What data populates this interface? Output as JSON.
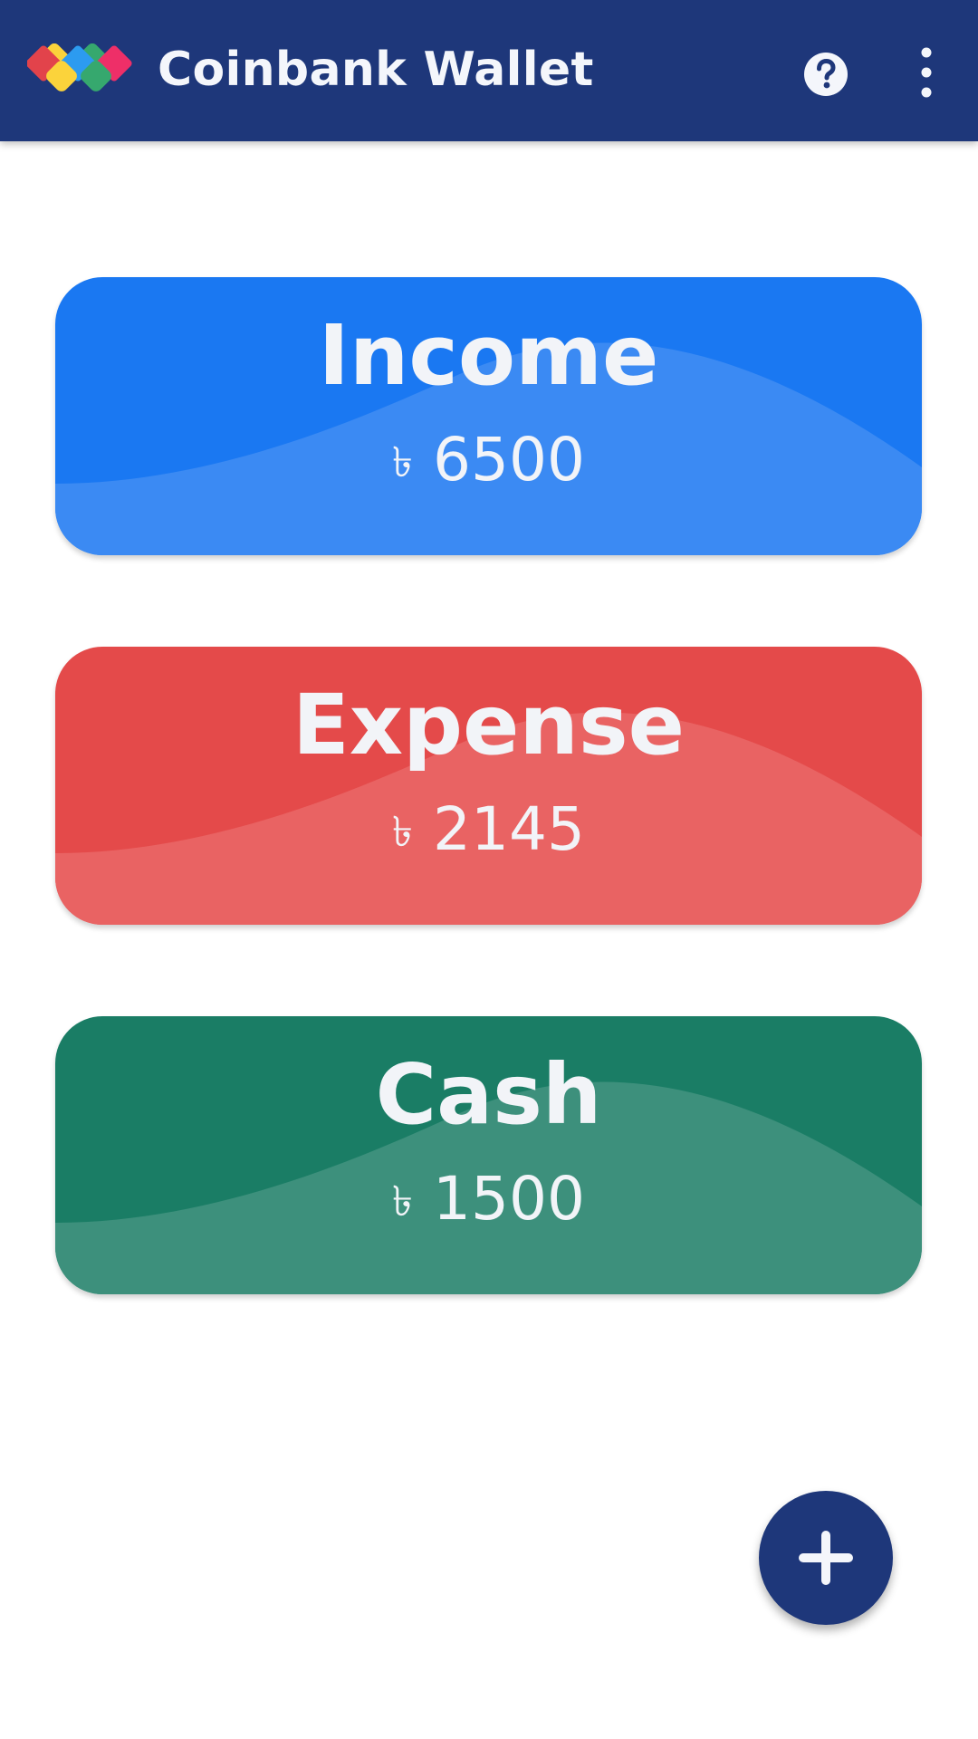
{
  "appbar": {
    "title": "Coinbank Wallet",
    "logo_icon": "coinbank-diamonds-logo",
    "help_icon": "help-circle-icon",
    "more_icon": "more-vertical-icon",
    "background_color": "#1e377a"
  },
  "cards": [
    {
      "title": "Income",
      "currency_symbol": "৳",
      "amount": "6500",
      "color_base": "#1a78f2",
      "color_wave": "#3b8af3"
    },
    {
      "title": "Expense",
      "currency_symbol": "৳",
      "amount": "2145",
      "color_base": "#e44a4a",
      "color_wave": "#e96363"
    },
    {
      "title": "Cash",
      "currency_symbol": "৳",
      "amount": "1500",
      "color_base": "#1a7d65",
      "color_wave": "#3d907c"
    }
  ],
  "fab": {
    "icon": "plus-icon",
    "color": "#1e377a"
  }
}
